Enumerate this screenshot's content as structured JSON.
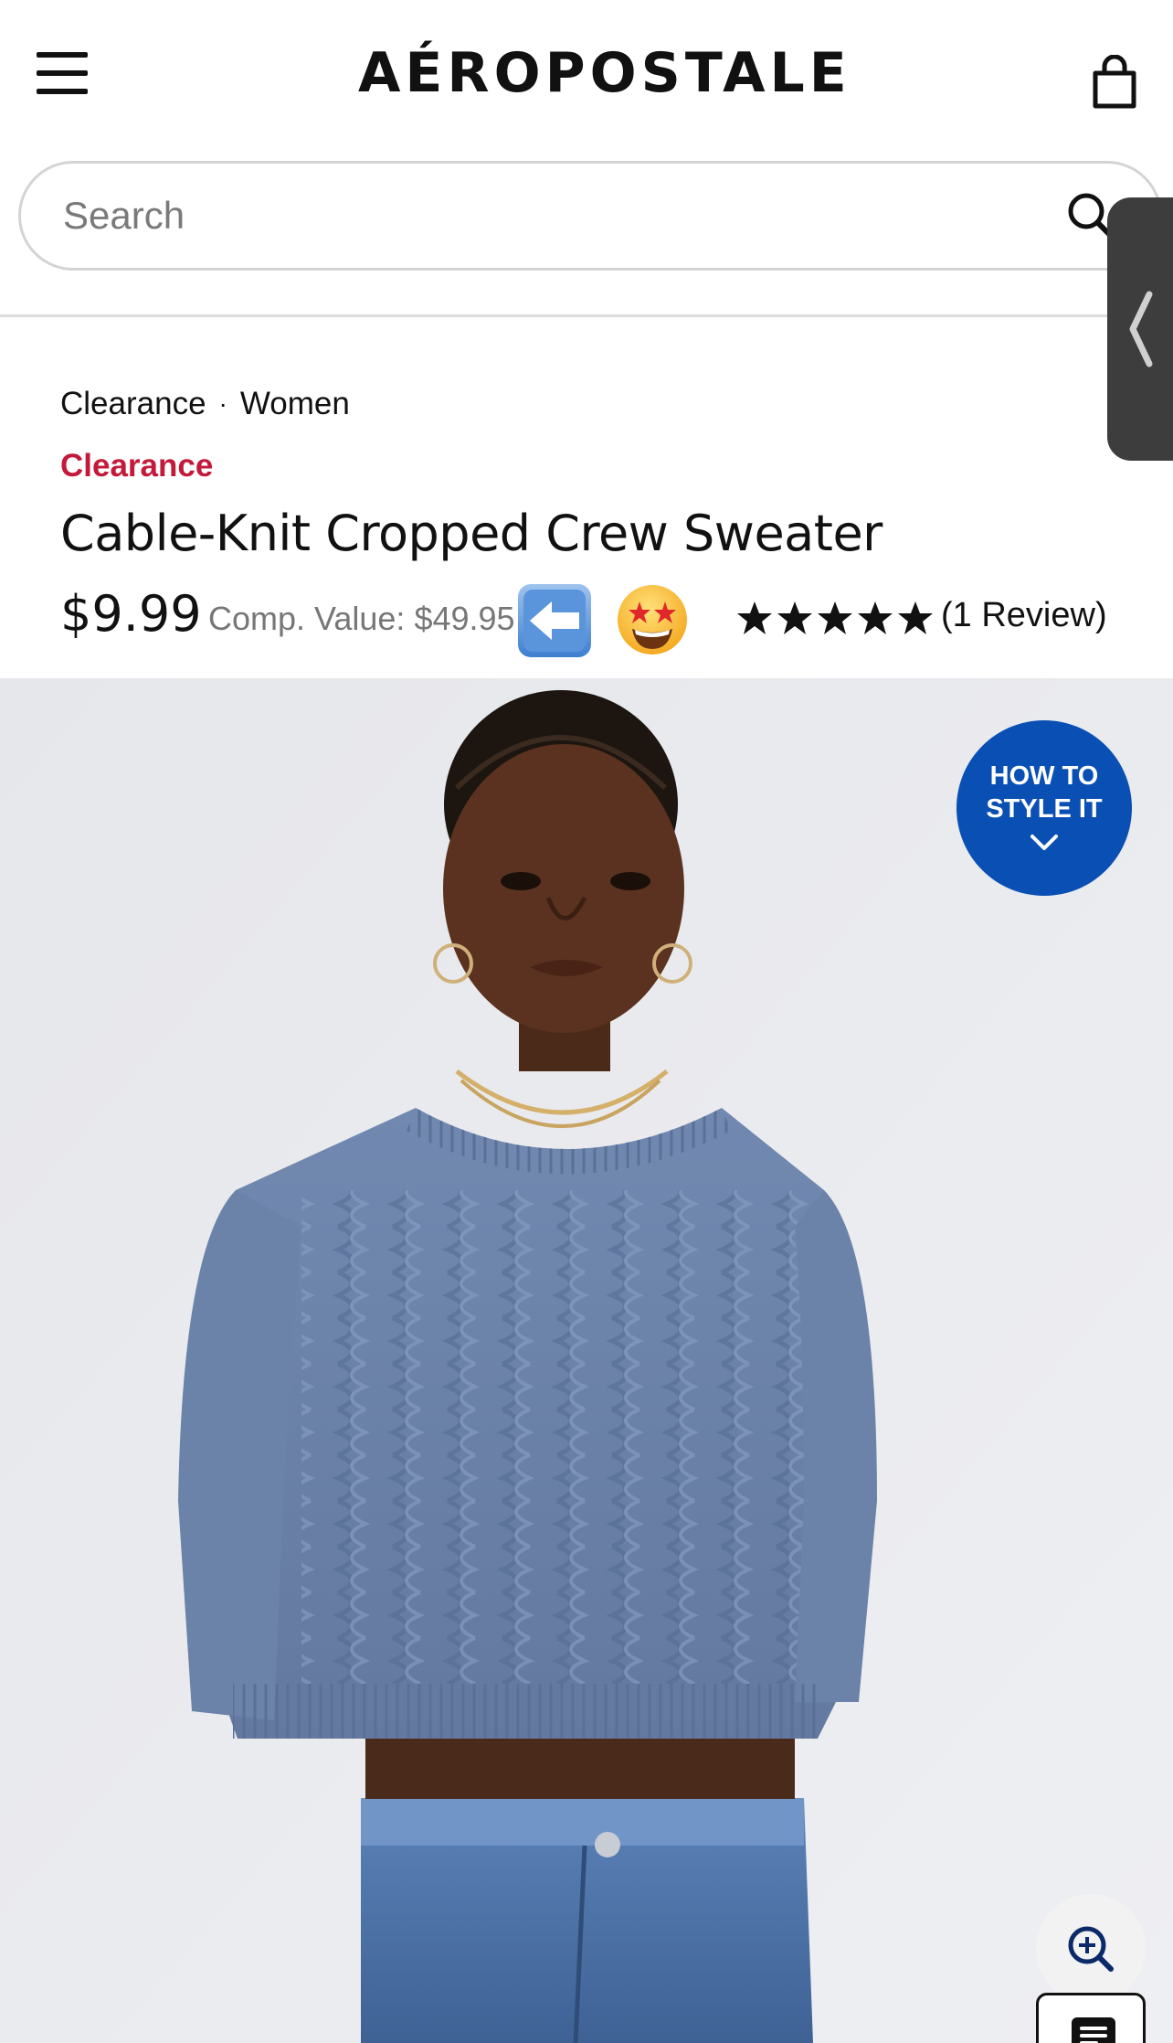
{
  "header": {
    "logo_text": "AÉROPOSTALE",
    "menu_icon": "hamburger-menu-icon",
    "bag_icon": "shopping-bag-icon"
  },
  "search": {
    "placeholder": "Search",
    "value": "",
    "icon": "search-icon"
  },
  "side_panel": {
    "icon": "chevron-left-icon"
  },
  "breadcrumb": {
    "items": [
      "Clearance",
      "Women"
    ],
    "separator": "·"
  },
  "product": {
    "badge": "Clearance",
    "badge_color": "#c3193b",
    "title": "Cable-Knit Cropped Crew Sweater",
    "price": "$9.99",
    "comp_value": "Comp. Value: $49.95",
    "emojis": [
      "left-arrow-emoji",
      "star-struck-emoji"
    ],
    "rating": 5,
    "rating_max": 5,
    "review_count": "(1 Review)"
  },
  "image": {
    "alt": "model-wearing-blue-cable-knit-sweater",
    "sweater_color": "#6f86ad",
    "background_color": "#e9eaee"
  },
  "style_button": {
    "line1": "HOW TO",
    "line2": "STYLE IT",
    "color": "#0a50b4",
    "icon": "chevron-down-icon"
  },
  "zoom_button": {
    "icon": "zoom-in-icon"
  },
  "chat_button": {
    "icon": "chat-icon"
  }
}
